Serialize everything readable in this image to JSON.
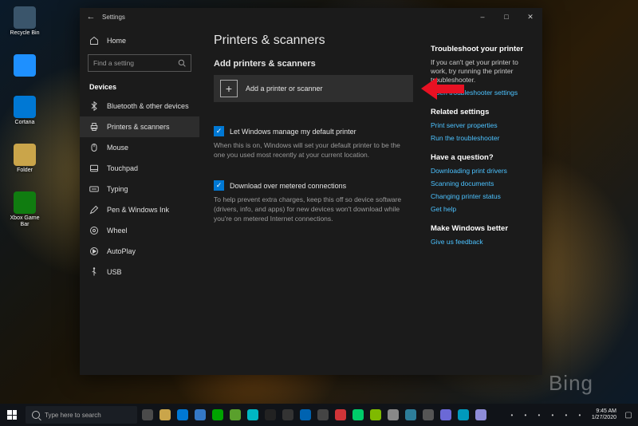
{
  "desktop": {
    "icons": [
      {
        "label": "Recycle Bin",
        "color": "#3a556b"
      },
      {
        "label": "",
        "color": "#1e90ff"
      },
      {
        "label": "Cortana",
        "color": "#0078d4"
      },
      {
        "label": "Folder",
        "color": "#caa54a"
      },
      {
        "label": "Xbox Game Bar",
        "color": "#107c10"
      }
    ],
    "watermark": "Bing"
  },
  "taskbar": {
    "search_placeholder": "Type here to search",
    "tray_time": "9:45 AM",
    "tray_date": "1/27/2020",
    "app_colors": [
      "#4a4a4a",
      "#caa54a",
      "#0078d4",
      "#3478c6",
      "#00a300",
      "#5aa02c",
      "#00b7c3",
      "#222",
      "#333",
      "#0063b1",
      "#444",
      "#d13438",
      "#00cc6a",
      "#7fba00",
      "#888",
      "#2d7d9a",
      "#555",
      "#6b69d6",
      "#0099bc",
      "#8e8cd8"
    ],
    "tray_icons": [
      "^",
      "bt",
      "vol",
      "wifi",
      "batt",
      "key"
    ]
  },
  "window": {
    "app": "Settings",
    "page_title": "Printers & scanners",
    "sidebar": {
      "home": "Home",
      "search_placeholder": "Find a setting",
      "category": "Devices",
      "items": [
        {
          "icon": "bt",
          "label": "Bluetooth & other devices"
        },
        {
          "icon": "printer",
          "label": "Printers & scanners"
        },
        {
          "icon": "mouse",
          "label": "Mouse"
        },
        {
          "icon": "touchpad",
          "label": "Touchpad"
        },
        {
          "icon": "keyboard",
          "label": "Typing"
        },
        {
          "icon": "pen",
          "label": "Pen & Windows Ink"
        },
        {
          "icon": "wheel",
          "label": "Wheel"
        },
        {
          "icon": "autoplay",
          "label": "AutoPlay"
        },
        {
          "icon": "usb",
          "label": "USB"
        }
      ],
      "selected_index": 1
    },
    "main": {
      "add_heading": "Add printers & scanners",
      "add_button": "Add a printer or scanner",
      "opt1_label": "Let Windows manage my default printer",
      "opt1_desc": "When this is on, Windows will set your default printer to be the one you used most recently at your current location.",
      "opt2_label": "Download over metered connections",
      "opt2_desc": "To help prevent extra charges, keep this off so device software (drivers, info, and apps) for new devices won't download while you're on metered Internet connections."
    },
    "right": {
      "troubleshoot_h": "Troubleshoot your printer",
      "troubleshoot_t": "If you can't get your printer to work, try running the printer troubleshooter.",
      "troubleshoot_link": "Open troubleshooter settings",
      "related_h": "Related settings",
      "related_links": [
        "Print server properties",
        "Run the troubleshooter"
      ],
      "question_h": "Have a question?",
      "question_links": [
        "Downloading print drivers",
        "Scanning documents",
        "Changing printer status",
        "Get help"
      ],
      "better_h": "Make Windows better",
      "better_link": "Give us feedback"
    }
  }
}
